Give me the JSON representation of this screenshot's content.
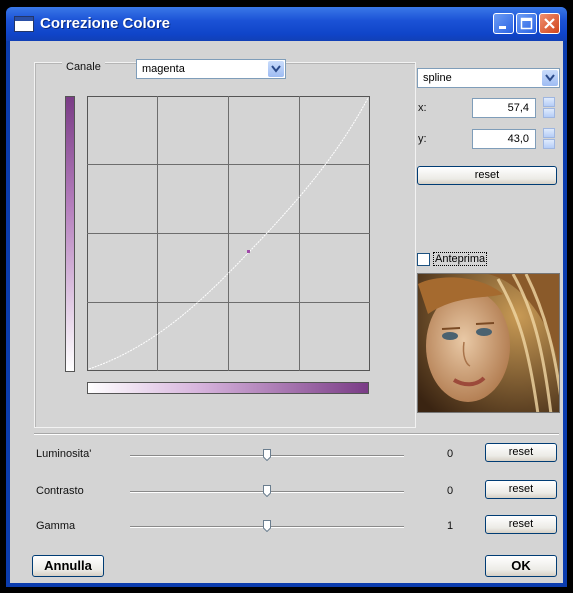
{
  "window": {
    "title": "Correzione Colore"
  },
  "channel": {
    "label": "Canale",
    "selected": "magenta"
  },
  "curve": {
    "mode": "spline",
    "x_label": "x:",
    "x_value": "57,4",
    "y_label": "y:",
    "y_value": "43,0",
    "reset_label": "reset"
  },
  "preview": {
    "label": "Anteprima",
    "checked": false
  },
  "sliders": [
    {
      "label": "Luminosita'",
      "value": "0",
      "reset_label": "reset",
      "position": 0.5
    },
    {
      "label": "Contrasto",
      "value": "0",
      "reset_label": "reset",
      "position": 0.5
    },
    {
      "label": "Gamma",
      "value": "1",
      "reset_label": "reset",
      "position": 0.5
    }
  ],
  "buttons": {
    "cancel": "Annulla",
    "ok": "OK"
  },
  "colors": {
    "titlebar": "#1b52d6",
    "dialog_bg": "#d4d4d4",
    "channel_color": "#8a4a96",
    "curve_point": "#a04aa8"
  }
}
